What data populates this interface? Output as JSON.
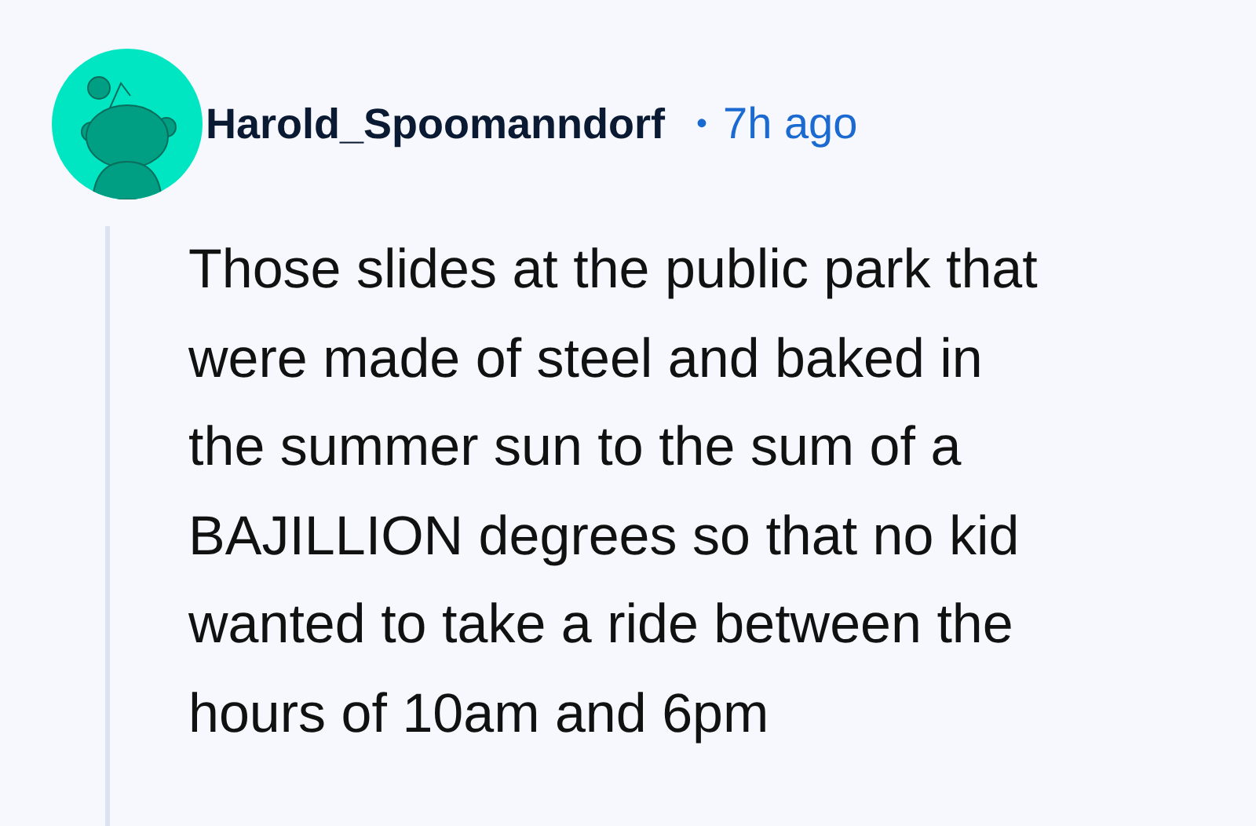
{
  "comment": {
    "author": "Harold_Spoomanndorf",
    "separator": "•",
    "time": "7h ago",
    "body_lines": [
      "Those slides at the public park that",
      "were made of steel and baked in",
      "the summer sun to the sum of a",
      "BAJILLION degrees so that no kid",
      "wanted to take a ride between the",
      "hours of 10am and 6pm"
    ]
  }
}
